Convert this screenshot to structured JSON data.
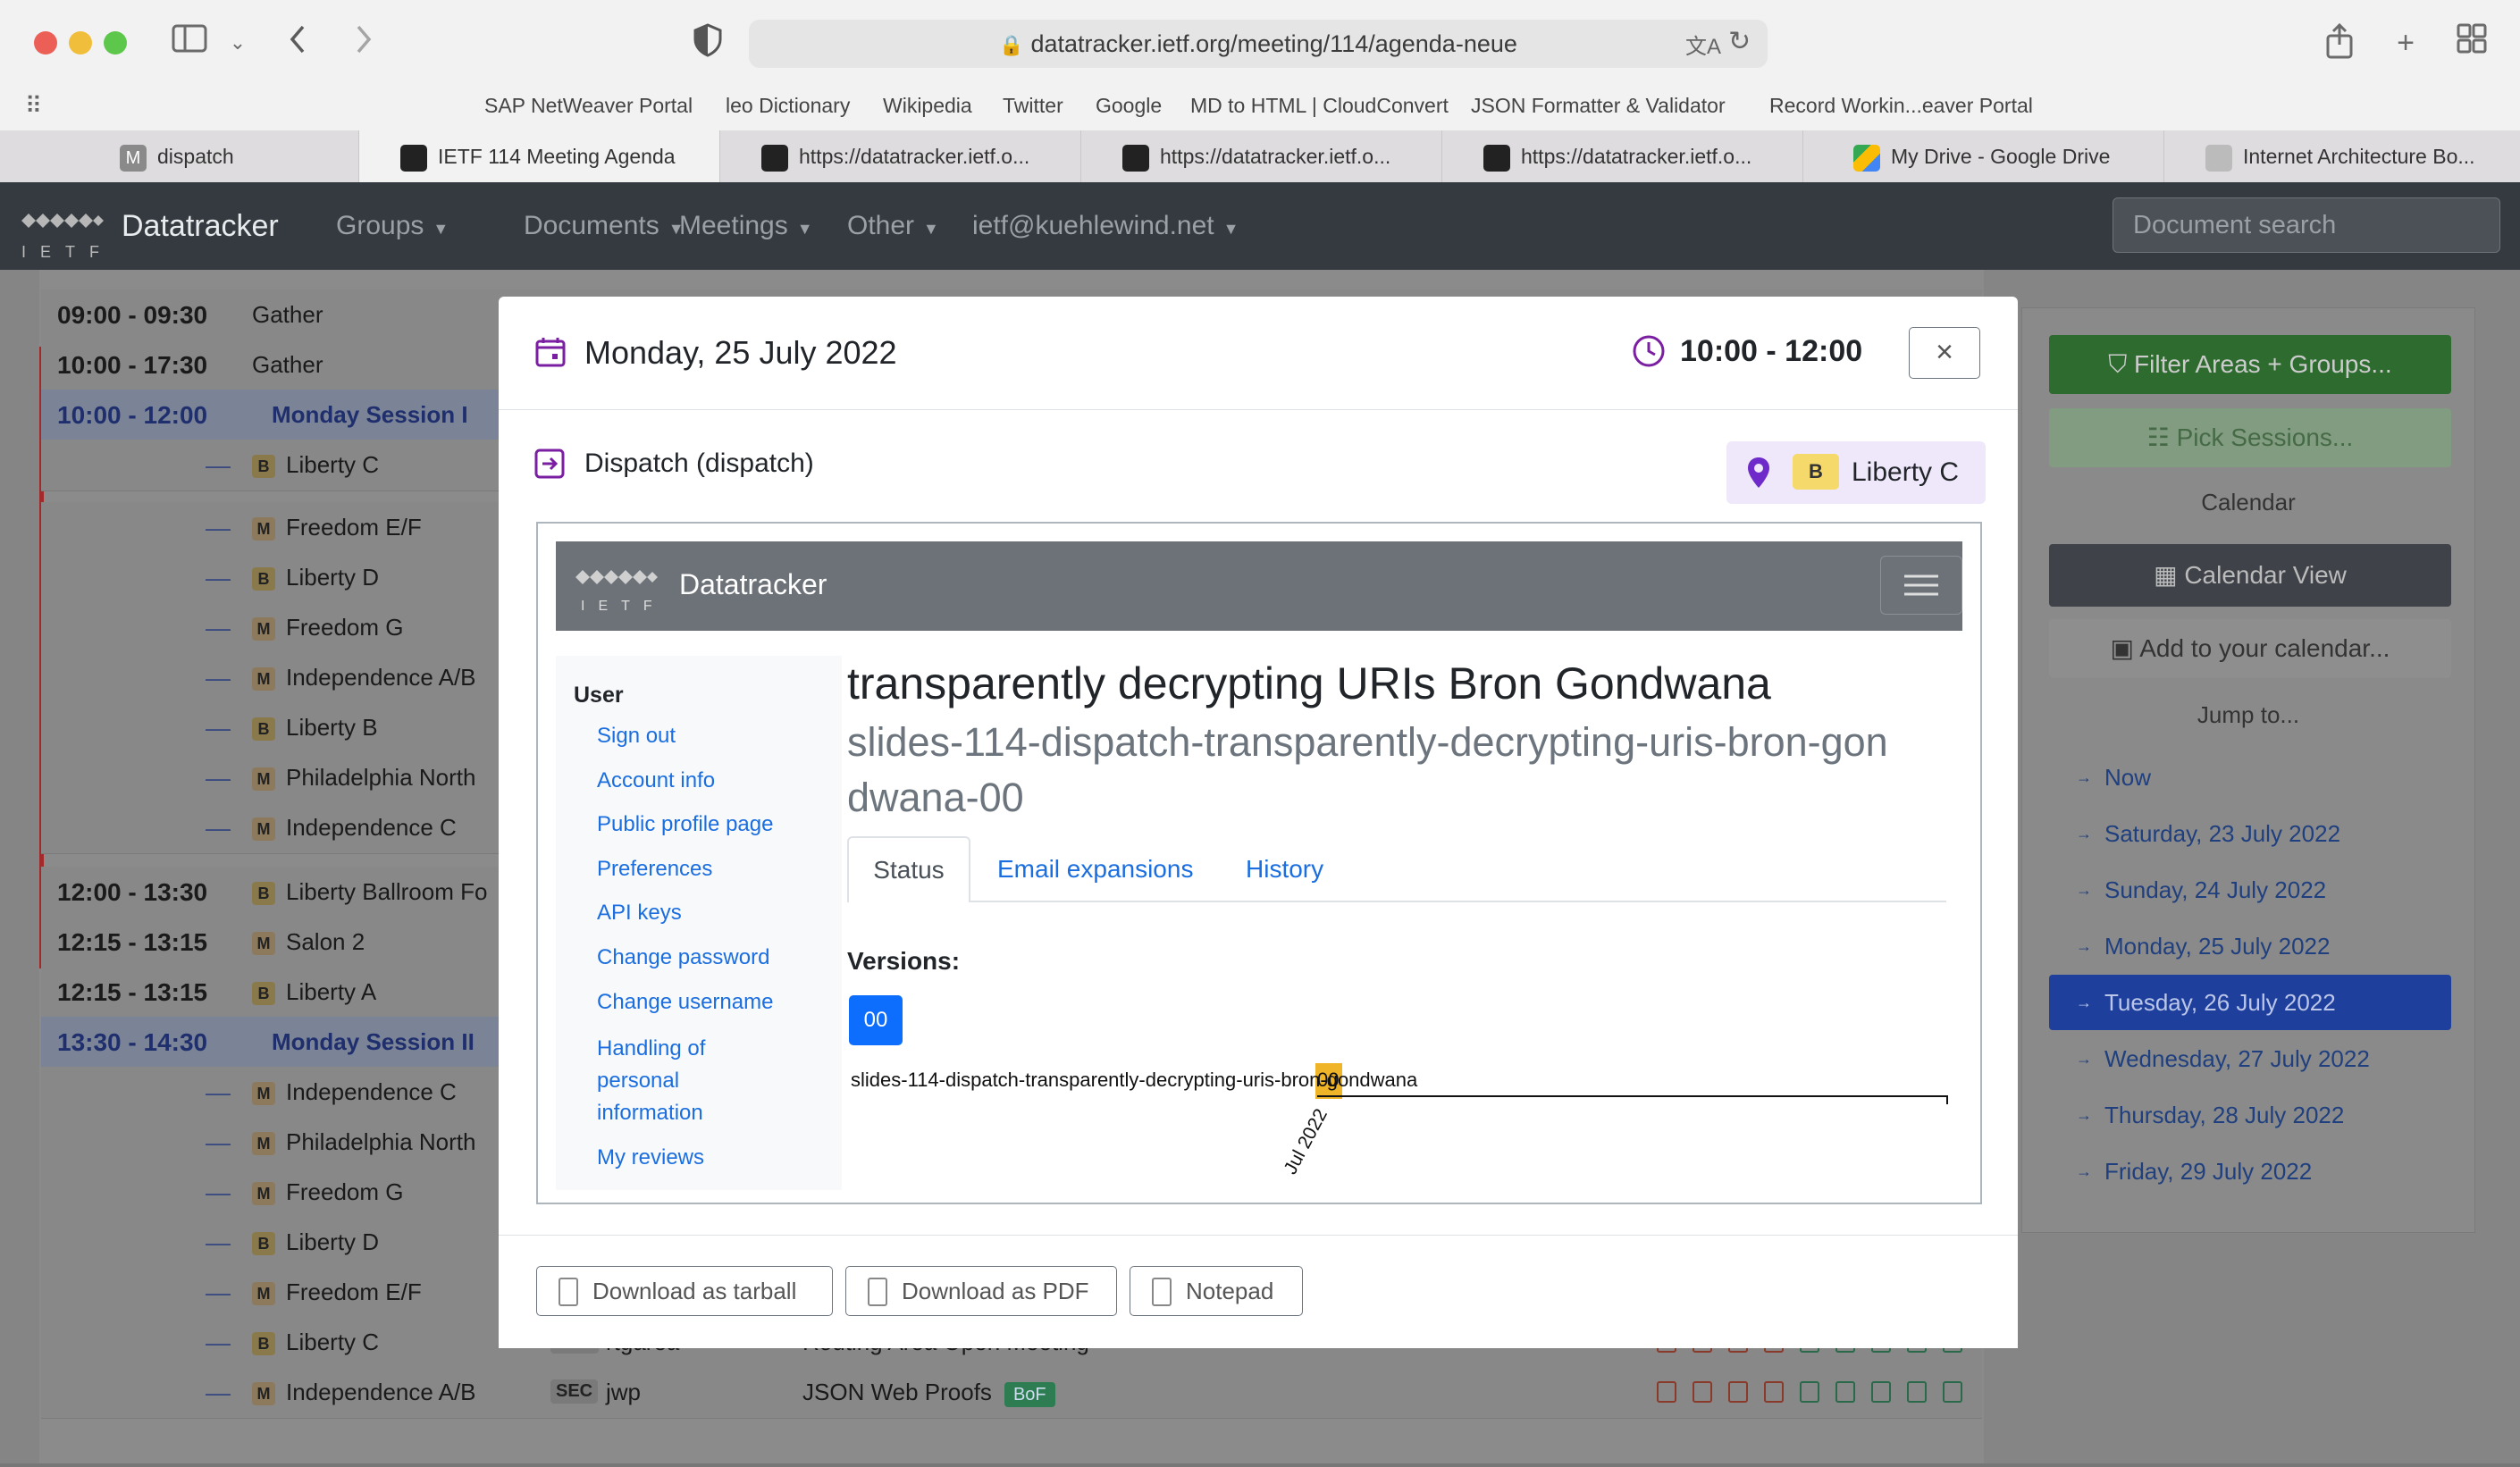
{
  "browser": {
    "url": "datatracker.ietf.org/meeting/114/agenda-neue",
    "bookmarks": [
      "SAP NetWeaver Portal",
      "leo Dictionary",
      "Wikipedia",
      "Twitter",
      "Google",
      "MD to HTML | CloudConvert",
      "JSON Formatter & Validator",
      "Record Workin...eaver Portal"
    ],
    "tabs": [
      {
        "label": "dispatch",
        "icon": "M"
      },
      {
        "label": "IETF 114 Meeting Agenda"
      },
      {
        "label": "https://datatracker.ietf.o..."
      },
      {
        "label": "https://datatracker.ietf.o..."
      },
      {
        "label": "https://datatracker.ietf.o..."
      },
      {
        "label": "My Drive - Google Drive"
      },
      {
        "label": "Internet Architecture Bo..."
      }
    ]
  },
  "navbar": {
    "brand": "Datatracker",
    "logo_text": "IETF",
    "items": [
      "Groups",
      "Documents",
      "Meetings",
      "Other",
      "ietf@kuehlewind.net"
    ],
    "search_placeholder": "Document search"
  },
  "agenda": {
    "rows": [
      {
        "time": "09:00 - 09:30",
        "room": "Gather"
      },
      {
        "time": "10:00 - 17:30",
        "room": "Gather"
      },
      {
        "time": "10:00 - 12:00",
        "room": "Monday Session I",
        "session": true
      },
      {
        "time": "—",
        "room": "Liberty C",
        "badge": "B"
      },
      {
        "time": "—",
        "room": "Freedom E/F",
        "badge": "M"
      },
      {
        "time": "—",
        "room": "Liberty D",
        "badge": "B"
      },
      {
        "time": "—",
        "room": "Freedom G",
        "badge": "M"
      },
      {
        "time": "—",
        "room": "Independence A/B",
        "badge": "M"
      },
      {
        "time": "—",
        "room": "Liberty B",
        "badge": "B"
      },
      {
        "time": "—",
        "room": "Philadelphia North",
        "badge": "M"
      },
      {
        "time": "—",
        "room": "Independence C",
        "badge": "M"
      },
      {
        "time": "12:00 - 13:30",
        "room": "Liberty Ballroom Fo",
        "badge": "B"
      },
      {
        "time": "12:15 - 13:15",
        "room": "Salon 2",
        "badge": "M"
      },
      {
        "time": "12:15 - 13:15",
        "room": "Liberty A",
        "badge": "B"
      },
      {
        "time": "13:30 - 14:30",
        "room": "Monday Session II",
        "session": true
      },
      {
        "time": "—",
        "room": "Independence C",
        "badge": "M"
      },
      {
        "time": "—",
        "room": "Philadelphia North",
        "badge": "M"
      },
      {
        "time": "—",
        "room": "Freedom G",
        "badge": "M"
      },
      {
        "time": "—",
        "room": "Liberty D",
        "badge": "B"
      },
      {
        "time": "—",
        "room": "Freedom E/F",
        "badge": "M"
      },
      {
        "time": "—",
        "room": "Liberty C",
        "badge": "B",
        "area": "RTG",
        "group": "rtgarea",
        "title": "Routing Area Open Meeting"
      },
      {
        "time": "—",
        "room": "Independence A/B",
        "badge": "M",
        "area": "SEC",
        "group": "jwp",
        "title": "JSON Web Proofs",
        "tag": "BoF"
      }
    ]
  },
  "sidebar": {
    "filter_label": "Filter Areas + Groups...",
    "pick_label": "Pick Sessions...",
    "calendar_heading": "Calendar",
    "calendar_view_label": "Calendar View",
    "add_calendar_label": "Add to your calendar...",
    "jump_heading": "Jump to...",
    "jump_items": [
      "Now",
      "Saturday, 23 July 2022",
      "Sunday, 24 July 2022",
      "Monday, 25 July 2022",
      "Tuesday, 26 July 2022",
      "Wednesday, 27 July 2022",
      "Thursday, 28 July 2022",
      "Friday, 29 July 2022"
    ],
    "active_jump": "Tuesday, 26 July 2022"
  },
  "modal": {
    "date": "Monday, 25 July 2022",
    "time": "10:00 - 12:00",
    "close": "×",
    "session": "Dispatch (dispatch)",
    "room_badge": "B",
    "room": "Liberty C",
    "embedded": {
      "brand": "Datatracker",
      "user_heading": "User",
      "user_links": [
        "Sign out",
        "Account info",
        "Public profile page",
        "Preferences",
        "API keys",
        "Change password",
        "Change username",
        "Handling of personal information",
        "My reviews"
      ],
      "doc_title": "transparently decrypting URIs Bron Gondwana",
      "doc_name": "slides-114-dispatch-transparently-decrypting-uris-bron-gondwana-00",
      "tabs": [
        "Status",
        "Email expansions",
        "History"
      ],
      "active_tab": "Status",
      "versions_label": "Versions:",
      "version": "00",
      "timeline_label": "slides-114-dispatch-transparently-decrypting-uris-bron-gondwana",
      "timeline_marker": "00",
      "timeline_date": "Jul 2022"
    },
    "footer": [
      "Download as tarball",
      "Download as PDF",
      "Notepad"
    ]
  },
  "colors": {
    "navbar": "#343a40",
    "primary": "#0d6efd",
    "success": "#2e7d32",
    "badge_b": "#f6d96b",
    "marker": "#f0b429"
  }
}
